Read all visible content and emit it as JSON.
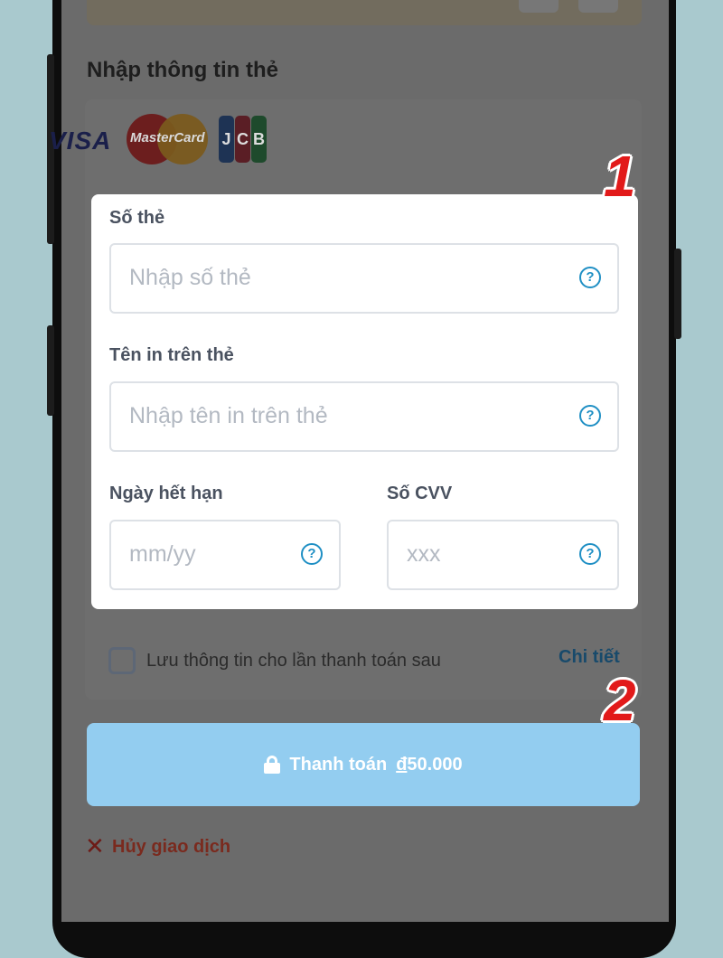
{
  "card_section": {
    "title": "Nhập thông tin thẻ",
    "logos": {
      "visa": "VISA",
      "mastercard": "MasterCard",
      "jcb": [
        "J",
        "C",
        "B"
      ]
    }
  },
  "form": {
    "card_number": {
      "label": "Số thẻ",
      "placeholder": "Nhập số thẻ"
    },
    "card_name": {
      "label": "Tên in trên thẻ",
      "placeholder": "Nhập tên in trên thẻ"
    },
    "expiry": {
      "label": "Ngày hết hạn",
      "placeholder": "mm/yy"
    },
    "cvv": {
      "label": "Số CVV",
      "placeholder": "xxx"
    },
    "help_glyph": "?"
  },
  "save": {
    "label": "Lưu thông tin cho lần thanh toán sau",
    "checked": false,
    "detail_link": "Chi tiết"
  },
  "pay_button": {
    "label": "Thanh toán",
    "currency": "đ",
    "amount": "50.000"
  },
  "cancel": {
    "label": "Hủy giao dịch",
    "icon": "close-icon"
  },
  "annotations": [
    "1",
    "2"
  ],
  "colors": {
    "accent": "#1f8fc4",
    "button": "#93cdf0",
    "cancel": "#7a2a1e",
    "marker": "#e21a1a"
  }
}
